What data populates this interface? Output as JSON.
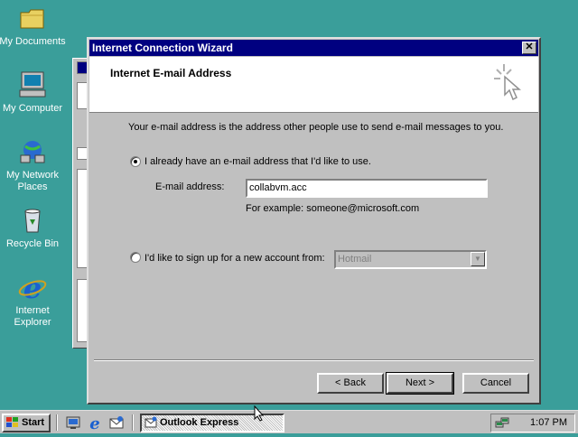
{
  "desktop": {
    "icons": [
      {
        "label": "My Documents",
        "icon": "folder-icon"
      },
      {
        "label": "My Computer",
        "icon": "computer-icon"
      },
      {
        "label": "My Network Places",
        "icon": "network-icon"
      },
      {
        "label": "Recycle Bin",
        "icon": "recycle-bin-icon"
      },
      {
        "label": "Internet Explorer",
        "icon": "ie-icon"
      }
    ]
  },
  "wizard": {
    "title": "Internet Connection Wizard",
    "header_title": "Internet E-mail Address",
    "intro": "Your e-mail address is the address other people use to send e-mail messages to you.",
    "option_existing": {
      "label": "I already have an e-mail address that I'd like to use.",
      "selected": true
    },
    "email_label": "E-mail address:",
    "email_value": "collabvm.acc",
    "example": "For example: someone@microsoft.com",
    "option_new": {
      "label": "I'd like to sign up for a new account from:",
      "selected": false
    },
    "provider_value": "Hotmail",
    "buttons": {
      "back": "< Back",
      "next": "Next >",
      "cancel": "Cancel"
    }
  },
  "taskbar": {
    "start_label": "Start",
    "task_label": "Outlook Express",
    "clock": "1:07 PM"
  },
  "colors": {
    "desktop": "#3a9e9a",
    "titlebar": "#000080",
    "face": "#c0c0c0"
  }
}
